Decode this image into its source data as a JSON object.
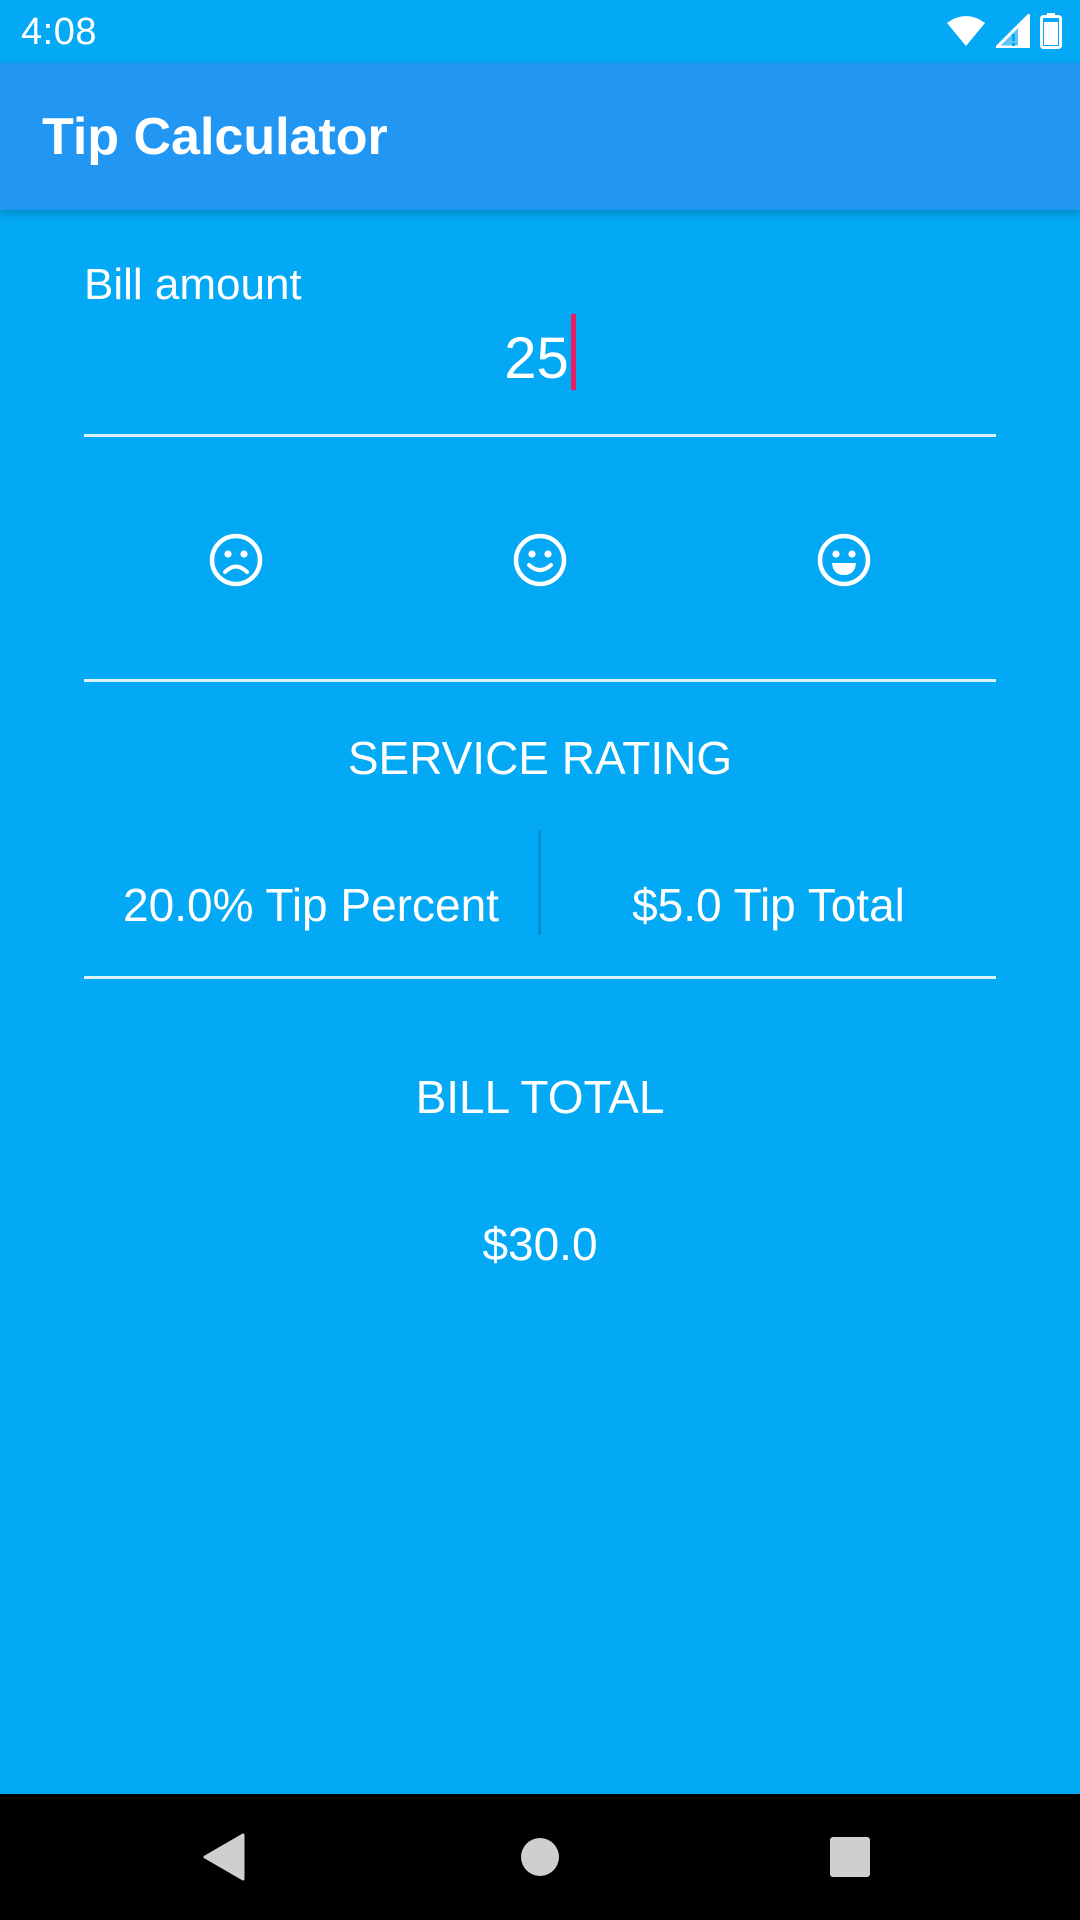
{
  "status_bar": {
    "time": "4:08",
    "icons": [
      "wifi-icon",
      "cellular-signal-icon",
      "battery-icon"
    ]
  },
  "app_bar": {
    "title": "Tip Calculator",
    "color": "#2196F3"
  },
  "bill": {
    "label": "Bill amount",
    "value": "25",
    "cursor_color": "#E91E63"
  },
  "service_rating": {
    "faces": [
      "sad-face-icon",
      "neutral-smile-icon",
      "happy-face-icon"
    ],
    "label": "SERVICE RATING"
  },
  "tip": {
    "percent_text": "20.0% Tip Percent",
    "total_text": "$5.0 Tip Total"
  },
  "bill_total": {
    "label": "BILL TOTAL",
    "value": "$30.0"
  },
  "nav_bar": {
    "buttons": [
      "back-icon",
      "home-icon",
      "recents-icon"
    ]
  },
  "colors": {
    "background": "#03A9F4",
    "app_bar": "#2196F3",
    "text": "#FFFFFF"
  }
}
